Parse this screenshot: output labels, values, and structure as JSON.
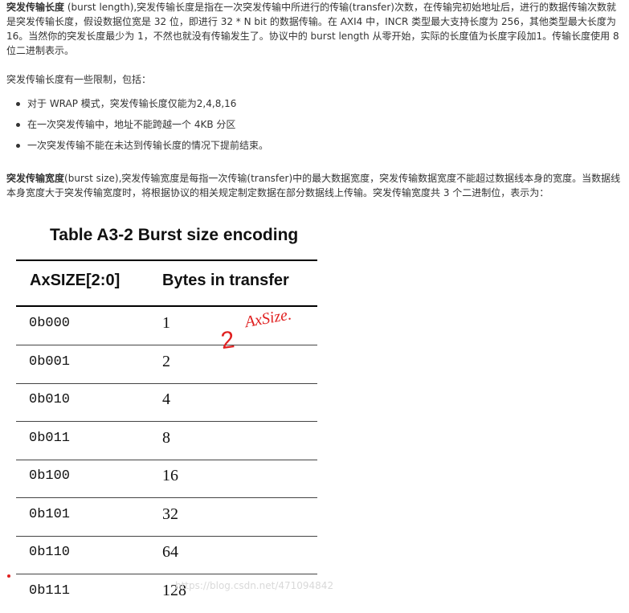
{
  "para1": {
    "bold": "突发传输长度",
    "text": " (burst length),突发传输长度是指在一次突发传输中所进行的传输(transfer)次数，在传输完初始地址后，进行的数据传输次数就是突发传输长度，假设数据位宽是 32 位，即进行 32 * N bit 的数据传输。在 AXI4 中，INCR 类型最大支持长度为 256，其他类型最大长度为 16。当然你的突发长度最少为 1，不然也就没有传输发生了。协议中的 burst length 从零开始，实际的长度值为长度字段加1。传输长度使用 8 位二进制表示。"
  },
  "para2": "突发传输长度有一些限制，包括：",
  "bullets": [
    "对于 WRAP 模式，突发传输长度仅能为2,4,8,16",
    "在一次突发传输中，地址不能跨越一个 4KB 分区",
    "一次突发传输不能在未达到传输长度的情况下提前结束。"
  ],
  "para3": {
    "bold": "突发传输宽度",
    "text": "(burst size),突发传输宽度是每指一次传输(transfer)中的最大数据宽度，突发传输数据宽度不能超过数据线本身的宽度。当数据线本身宽度大于突发传输宽度时，将根据协议的相关规定制定数据在部分数据线上传输。突发传输宽度共 3 个二进制位，表示为："
  },
  "table": {
    "title": "Table A3-2 Burst size encoding",
    "headers": [
      "AxSIZE[2:0]",
      "Bytes in transfer"
    ],
    "rows": [
      [
        "0b000",
        "1"
      ],
      [
        "0b001",
        "2"
      ],
      [
        "0b010",
        "4"
      ],
      [
        "0b011",
        "8"
      ],
      [
        "0b100",
        "16"
      ],
      [
        "0b101",
        "32"
      ],
      [
        "0b110",
        "64"
      ],
      [
        "0b111",
        "128"
      ]
    ]
  },
  "annotation": {
    "number": "2",
    "label": "AxSize.",
    "color": "#e02020"
  },
  "watermark": "https://blog.csdn.net/4710948​42"
}
